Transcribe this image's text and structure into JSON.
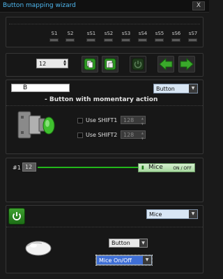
{
  "window": {
    "title": "Button mapping wizard",
    "close_label": "X"
  },
  "slots": [
    "S1",
    "S2",
    "sS1",
    "sS2",
    "sS3",
    "sS4",
    "sS5",
    "sS6",
    "sS7"
  ],
  "toolbar": {
    "index_value": "12"
  },
  "button_section": {
    "name_value": "B",
    "type_value": "Button",
    "description": "- Button with momentary action",
    "shift1_label": "Use SHIFT1",
    "shift1_value": "128",
    "shift2_label": "Use SHIFT2",
    "shift2_value": "128"
  },
  "mapping_row": {
    "id_label": "#1",
    "index_value": "12",
    "target_label": "Mice",
    "state_label": "ON / OFF"
  },
  "bottom_section": {
    "device_value": "Mice",
    "action_type_value": "Button",
    "action_value": "Mice On/Off"
  },
  "colors": {
    "accent": "#4fb8f0",
    "green": "#2e9b22",
    "line": "#22b81b"
  }
}
